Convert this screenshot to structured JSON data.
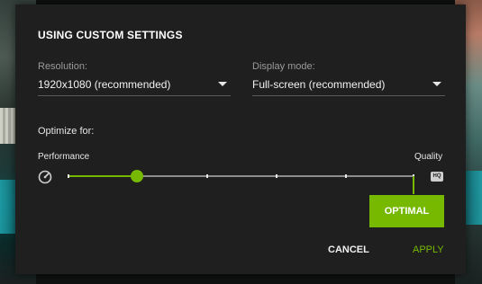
{
  "dialog": {
    "title": "USING CUSTOM SETTINGS",
    "resolution": {
      "label": "Resolution:",
      "value": "1920x1080 (recommended)"
    },
    "display_mode": {
      "label": "Display mode:",
      "value": "Full-screen (recommended)"
    },
    "optimize": {
      "label": "Optimize for:",
      "left_label": "Performance",
      "right_label": "Quality",
      "right_icon_text": "HQ",
      "slider_level": 0.2,
      "tick_count": 6,
      "optimal_label": "OPTIMAL"
    },
    "buttons": {
      "cancel": "CANCEL",
      "apply": "APPLY"
    }
  },
  "colors": {
    "accent": "#76b900",
    "panel": "#1f1f1f",
    "text": "#f2f2f2",
    "muted": "#9a9a9a"
  },
  "icons": {
    "performance": "speedometer-icon",
    "quality": "hq-icon"
  }
}
